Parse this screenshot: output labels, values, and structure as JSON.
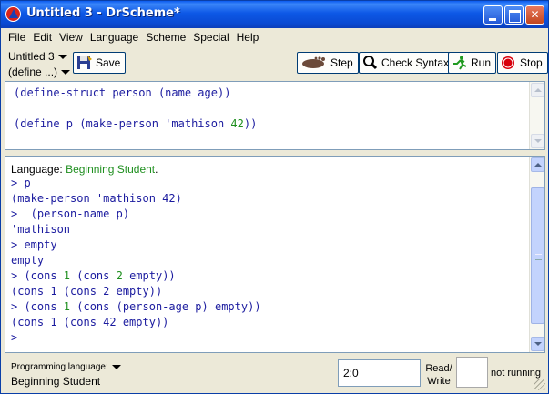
{
  "window": {
    "title": "Untitled 3 - DrScheme*",
    "min_symbol": "",
    "max_symbol": "",
    "close_symbol": "✕"
  },
  "menubar": {
    "items": [
      "File",
      "Edit",
      "View",
      "Language",
      "Scheme",
      "Special",
      "Help"
    ]
  },
  "toolbar": {
    "file_name": "Untitled 3",
    "define_menu": "(define ...)",
    "save_label": "Save",
    "step_label": "Step",
    "check_syntax_label": "Check Syntax",
    "run_label": "Run",
    "stop_label": "Stop"
  },
  "definitions": {
    "line1_code": "(define-struct person (name age))",
    "line2_prefix": "(define p (make-person 'mathison ",
    "line2_num": "42",
    "line2_suffix": "))"
  },
  "interactions": {
    "lang_prefix": "Language: ",
    "lang_name": "Beginning Student",
    "lang_suffix": ".",
    "l1": "> p",
    "l2": "(make-person 'mathison 42)",
    "l3": ">  (person-name p)",
    "l4": "'mathison",
    "l5": "> empty",
    "l6": "empty",
    "l7_a": "> (cons ",
    "l7_n1": "1",
    "l7_b": " (cons ",
    "l7_n2": "2",
    "l7_c": " empty))",
    "l8": "(cons 1 (cons 2 empty))",
    "l9_a": "> (cons ",
    "l9_n1": "1",
    "l9_b": " (cons (person-age p) empty))",
    "l10": "(cons 1 (cons 42 empty))",
    "l11": ">"
  },
  "statusbar": {
    "programming_language_label": "Programming language:",
    "language": "Beginning Student",
    "position": "2:0",
    "read_write_line1": "Read/",
    "read_write_line2": "Write",
    "run_status": "not running"
  }
}
